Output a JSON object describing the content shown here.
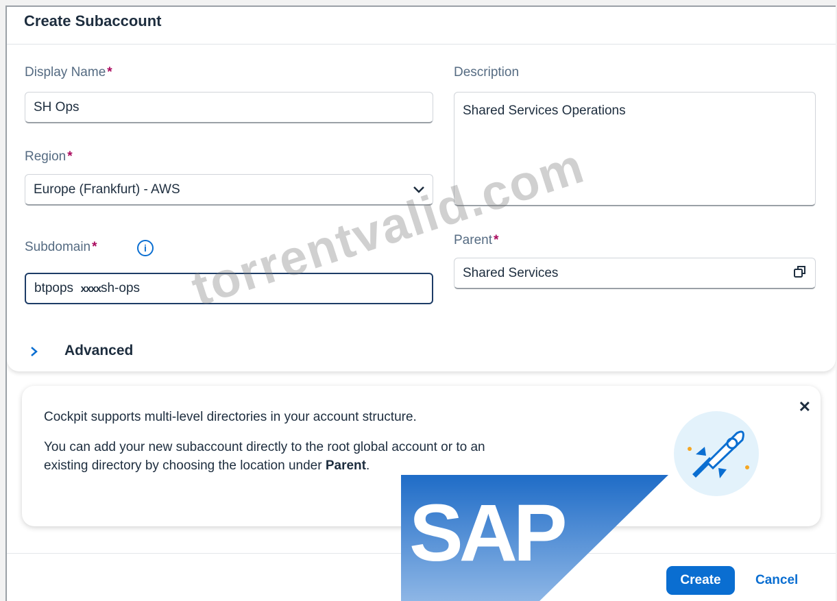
{
  "dialog": {
    "title": "Create Subaccount"
  },
  "form": {
    "display_name": {
      "label": "Display Name",
      "required": "*",
      "value": "SH Ops"
    },
    "description": {
      "label": "Description",
      "value": "Shared Services Operations"
    },
    "region": {
      "label": "Region",
      "required": "*",
      "value": "Europe (Frankfurt) - AWS"
    },
    "subdomain": {
      "label": "Subdomain",
      "required": "*",
      "value_prefix": "btpops",
      "value_masked": "xxxx",
      "value_suffix": "sh-ops"
    },
    "parent": {
      "label": "Parent",
      "required": "*",
      "value": "Shared Services"
    },
    "advanced": {
      "label": "Advanced"
    }
  },
  "info_strip": {
    "line1": "Cockpit supports multi-level directories in your account structure.",
    "line2": "You can add your new subaccount directly to the root global account or to an",
    "line3_prefix": "existing directory by choosing the location under ",
    "line3_bold": "Parent",
    "line3_end": ".",
    "close_symbol": "✕"
  },
  "footer": {
    "create_label": "Create",
    "cancel_label": "Cancel"
  },
  "watermark": {
    "text": "torrentvalid.com"
  },
  "logo": {
    "text": "SAP",
    "registered": "®"
  },
  "colors": {
    "accent": "#0a6ed1",
    "required_marker": "#aa0a5e",
    "label": "#556b82",
    "text": "#1d2d3e"
  },
  "icons": {
    "region_dropdown": "chevron-down-icon",
    "subdomain_info": "info-icon",
    "parent_picker": "value-help-icon",
    "advanced_toggle": "chevron-right-icon",
    "strip_close": "close-icon"
  }
}
